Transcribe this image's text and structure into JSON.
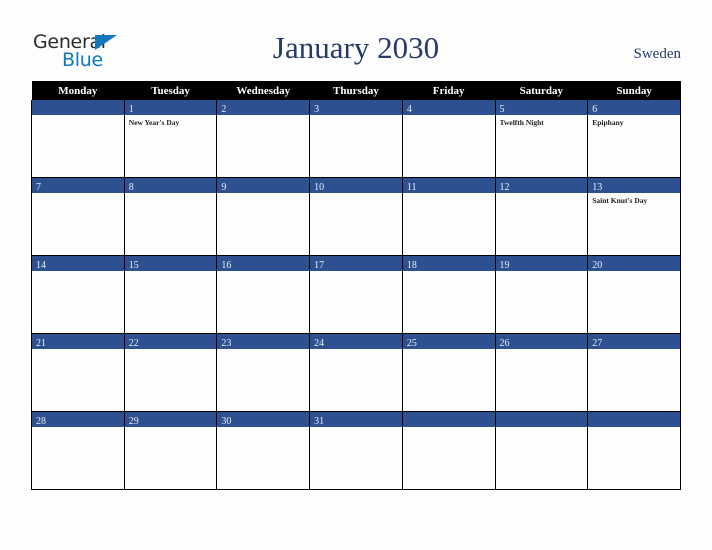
{
  "brand": {
    "line1": "General",
    "line2": "Blue",
    "triangle_color": "#1278be",
    "text_color": "#2b2b2b"
  },
  "header": {
    "title": "January 2030",
    "country": "Sweden",
    "title_color": "#243b66"
  },
  "theme": {
    "header_row_bg": "#000000",
    "day_bar_bg": "#2d5190",
    "day_number_color": "#e9edf5",
    "cell_bg": "#fdfdfd",
    "grid_border": "#000000",
    "page_bg": "#fdfdfd"
  },
  "calendar": {
    "month": "January",
    "year": "2030",
    "weekday_headers": [
      "Monday",
      "Tuesday",
      "Wednesday",
      "Thursday",
      "Friday",
      "Saturday",
      "Sunday"
    ],
    "weeks": [
      [
        {
          "day": "",
          "events": []
        },
        {
          "day": "1",
          "events": [
            "New Year's Day"
          ]
        },
        {
          "day": "2",
          "events": []
        },
        {
          "day": "3",
          "events": []
        },
        {
          "day": "4",
          "events": []
        },
        {
          "day": "5",
          "events": [
            "Twelfth Night"
          ]
        },
        {
          "day": "6",
          "events": [
            "Epiphany"
          ]
        }
      ],
      [
        {
          "day": "7",
          "events": []
        },
        {
          "day": "8",
          "events": []
        },
        {
          "day": "9",
          "events": []
        },
        {
          "day": "10",
          "events": []
        },
        {
          "day": "11",
          "events": []
        },
        {
          "day": "12",
          "events": []
        },
        {
          "day": "13",
          "events": [
            "Saint Knut's Day"
          ]
        }
      ],
      [
        {
          "day": "14",
          "events": []
        },
        {
          "day": "15",
          "events": []
        },
        {
          "day": "16",
          "events": []
        },
        {
          "day": "17",
          "events": []
        },
        {
          "day": "18",
          "events": []
        },
        {
          "day": "19",
          "events": []
        },
        {
          "day": "20",
          "events": []
        }
      ],
      [
        {
          "day": "21",
          "events": []
        },
        {
          "day": "22",
          "events": []
        },
        {
          "day": "23",
          "events": []
        },
        {
          "day": "24",
          "events": []
        },
        {
          "day": "25",
          "events": []
        },
        {
          "day": "26",
          "events": []
        },
        {
          "day": "27",
          "events": []
        }
      ],
      [
        {
          "day": "28",
          "events": []
        },
        {
          "day": "29",
          "events": []
        },
        {
          "day": "30",
          "events": []
        },
        {
          "day": "31",
          "events": []
        },
        {
          "day": "",
          "events": []
        },
        {
          "day": "",
          "events": []
        },
        {
          "day": "",
          "events": []
        }
      ]
    ]
  }
}
